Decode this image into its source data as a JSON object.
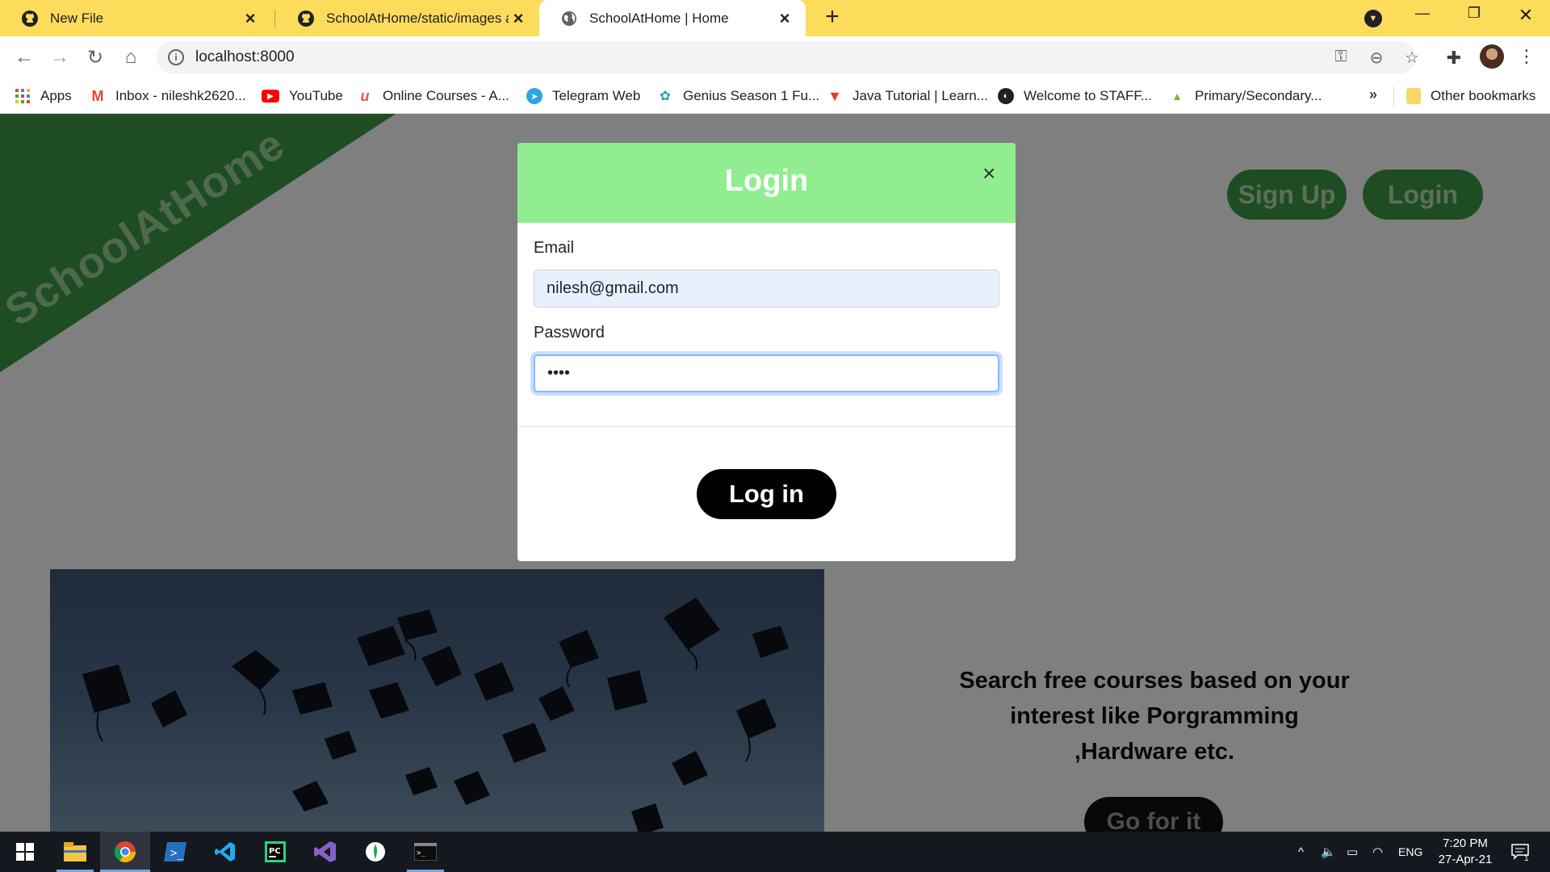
{
  "browser": {
    "tabs": [
      {
        "label": "New File",
        "icon": "github-icon"
      },
      {
        "label": "SchoolAtHome/static/images at r",
        "icon": "github-icon"
      },
      {
        "label": "SchoolAtHome | Home",
        "icon": "globe-icon",
        "active": true
      }
    ],
    "close_glyph": "×",
    "new_tab_glyph": "+",
    "url": "localhost:8000",
    "bookmarks": [
      {
        "label": "Apps",
        "icon": "apps-grid-icon"
      },
      {
        "label": "Inbox - nileshk2620...",
        "icon": "gmail-icon"
      },
      {
        "label": "YouTube",
        "icon": "youtube-icon"
      },
      {
        "label": "Online Courses - A...",
        "icon": "udemy-icon"
      },
      {
        "label": "Telegram Web",
        "icon": "telegram-icon"
      },
      {
        "label": "Genius Season 1 Fu...",
        "icon": "genius-icon"
      },
      {
        "label": "Java Tutorial | Learn...",
        "icon": "tpoint-icon"
      },
      {
        "label": "Welcome to STAFF...",
        "icon": "globe-icon"
      },
      {
        "label": "Primary/Secondary...",
        "icon": "android-icon"
      }
    ],
    "bookmarks_more": "»",
    "other_bookmarks": "Other bookmarks"
  },
  "page": {
    "brand": "SchoolAtHome",
    "signup_label": "Sign Up",
    "login_label": "Login",
    "tagline": "Search free courses based on your interest like Porgramming ,Hardware etc.",
    "cta_label": "Go for it"
  },
  "modal": {
    "title": "Login",
    "close_glyph": "×",
    "email_label": "Email",
    "email_value": "nilesh@gmail.com",
    "password_label": "Password",
    "password_value": "••••",
    "submit_label": "Log in"
  },
  "taskbar": {
    "apps": [
      "windows-start-icon",
      "file-explorer-icon",
      "chrome-icon",
      "powershell-icon",
      "vscode-icon",
      "pycharm-icon",
      "visual-studio-icon",
      "mongodb-compass-icon",
      "terminal-icon"
    ],
    "language": "ENG",
    "time": "7:20 PM",
    "date": "27-Apr-21",
    "notification_count": "1"
  },
  "colors": {
    "tab_bar": "#fddc5c",
    "brand_green": "#3e9a46",
    "modal_header": "#90ee90",
    "button_dark": "#000000"
  }
}
